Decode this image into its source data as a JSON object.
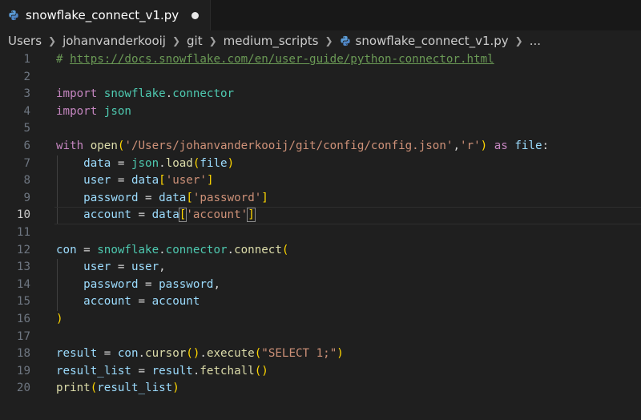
{
  "tab": {
    "filename": "snowflake_connect_v1.py",
    "icon": "python-file-icon",
    "modified_indicator": "unsaved-dot"
  },
  "breadcrumb": {
    "items": [
      "Users",
      "johanvanderkooij",
      "git",
      "medium_scripts",
      "snowflake_connect_v1.py",
      "..."
    ]
  },
  "editor": {
    "active_line": 10,
    "line_numbers": [
      "1",
      "2",
      "3",
      "4",
      "5",
      "6",
      "7",
      "8",
      "9",
      "10",
      "11",
      "12",
      "13",
      "14",
      "15",
      "16",
      "17",
      "18",
      "19",
      "20"
    ],
    "lines": [
      [
        [
          "cm",
          "# "
        ],
        [
          "link",
          "https://docs.snowflake.com/en/user-guide/python-connector.html"
        ]
      ],
      [],
      [
        [
          "kw",
          "import "
        ],
        [
          "mod",
          "snowflake"
        ],
        [
          "op",
          "."
        ],
        [
          "mod",
          "connector"
        ]
      ],
      [
        [
          "kw",
          "import "
        ],
        [
          "mod",
          "json"
        ]
      ],
      [],
      [
        [
          "kw",
          "with "
        ],
        [
          "fn",
          "open"
        ],
        [
          "br1",
          "("
        ],
        [
          "str",
          "'/Users/johanvanderkooij/git/config/config.json'"
        ],
        [
          "op",
          ","
        ],
        [
          "str",
          "'r'"
        ],
        [
          "br1",
          ")"
        ],
        [
          "op",
          " "
        ],
        [
          "kw",
          "as "
        ],
        [
          "var",
          "file"
        ],
        [
          "op",
          ":"
        ]
      ],
      [
        [
          "op",
          "    "
        ],
        [
          "var",
          "data"
        ],
        [
          "op",
          " = "
        ],
        [
          "mod",
          "json"
        ],
        [
          "op",
          "."
        ],
        [
          "fn",
          "load"
        ],
        [
          "br1",
          "("
        ],
        [
          "var",
          "file"
        ],
        [
          "br1",
          ")"
        ]
      ],
      [
        [
          "op",
          "    "
        ],
        [
          "var",
          "user"
        ],
        [
          "op",
          " = "
        ],
        [
          "var",
          "data"
        ],
        [
          "br1",
          "["
        ],
        [
          "str",
          "'user'"
        ],
        [
          "br1",
          "]"
        ]
      ],
      [
        [
          "op",
          "    "
        ],
        [
          "var",
          "password"
        ],
        [
          "op",
          " = "
        ],
        [
          "var",
          "data"
        ],
        [
          "br1",
          "["
        ],
        [
          "str",
          "'password'"
        ],
        [
          "br1",
          "]"
        ]
      ],
      [
        [
          "op",
          "    "
        ],
        [
          "var",
          "account"
        ],
        [
          "op",
          " = "
        ],
        [
          "var",
          "data"
        ],
        [
          "br1box",
          "["
        ],
        [
          "str",
          "'account'"
        ],
        [
          "br1box",
          "]"
        ],
        [
          "cursor",
          ""
        ]
      ],
      [],
      [
        [
          "var",
          "con"
        ],
        [
          "op",
          " = "
        ],
        [
          "mod",
          "snowflake"
        ],
        [
          "op",
          "."
        ],
        [
          "mod",
          "connector"
        ],
        [
          "op",
          "."
        ],
        [
          "fn",
          "connect"
        ],
        [
          "br1",
          "("
        ]
      ],
      [
        [
          "op",
          "    "
        ],
        [
          "var",
          "user"
        ],
        [
          "op",
          " = "
        ],
        [
          "var",
          "user"
        ],
        [
          "op",
          ","
        ]
      ],
      [
        [
          "op",
          "    "
        ],
        [
          "var",
          "password"
        ],
        [
          "op",
          " = "
        ],
        [
          "var",
          "password"
        ],
        [
          "op",
          ","
        ]
      ],
      [
        [
          "op",
          "    "
        ],
        [
          "var",
          "account"
        ],
        [
          "op",
          " = "
        ],
        [
          "var",
          "account"
        ]
      ],
      [
        [
          "br1",
          ")"
        ]
      ],
      [],
      [
        [
          "var",
          "result"
        ],
        [
          "op",
          " = "
        ],
        [
          "var",
          "con"
        ],
        [
          "op",
          "."
        ],
        [
          "fn",
          "cursor"
        ],
        [
          "br1",
          "()"
        ],
        [
          "op",
          "."
        ],
        [
          "fn",
          "execute"
        ],
        [
          "br1",
          "("
        ],
        [
          "str",
          "\"SELECT 1;\""
        ],
        [
          "br1",
          ")"
        ]
      ],
      [
        [
          "var",
          "result_list"
        ],
        [
          "op",
          " = "
        ],
        [
          "var",
          "result"
        ],
        [
          "op",
          "."
        ],
        [
          "fn",
          "fetchall"
        ],
        [
          "br1",
          "()"
        ]
      ],
      [
        [
          "fn",
          "print"
        ],
        [
          "br1",
          "("
        ],
        [
          "var",
          "result_list"
        ],
        [
          "br1",
          ")"
        ]
      ]
    ],
    "indent_guide_lines": [
      7,
      8,
      9,
      10,
      13,
      14,
      15
    ]
  },
  "colors": {
    "background": "#1f1f1f",
    "comment": "#6a9955",
    "keyword": "#c586c0",
    "module": "#4ec9b0",
    "function": "#dcdcaa",
    "variable": "#9cdcfe",
    "string": "#ce9178",
    "bracket": "#ffd700"
  }
}
